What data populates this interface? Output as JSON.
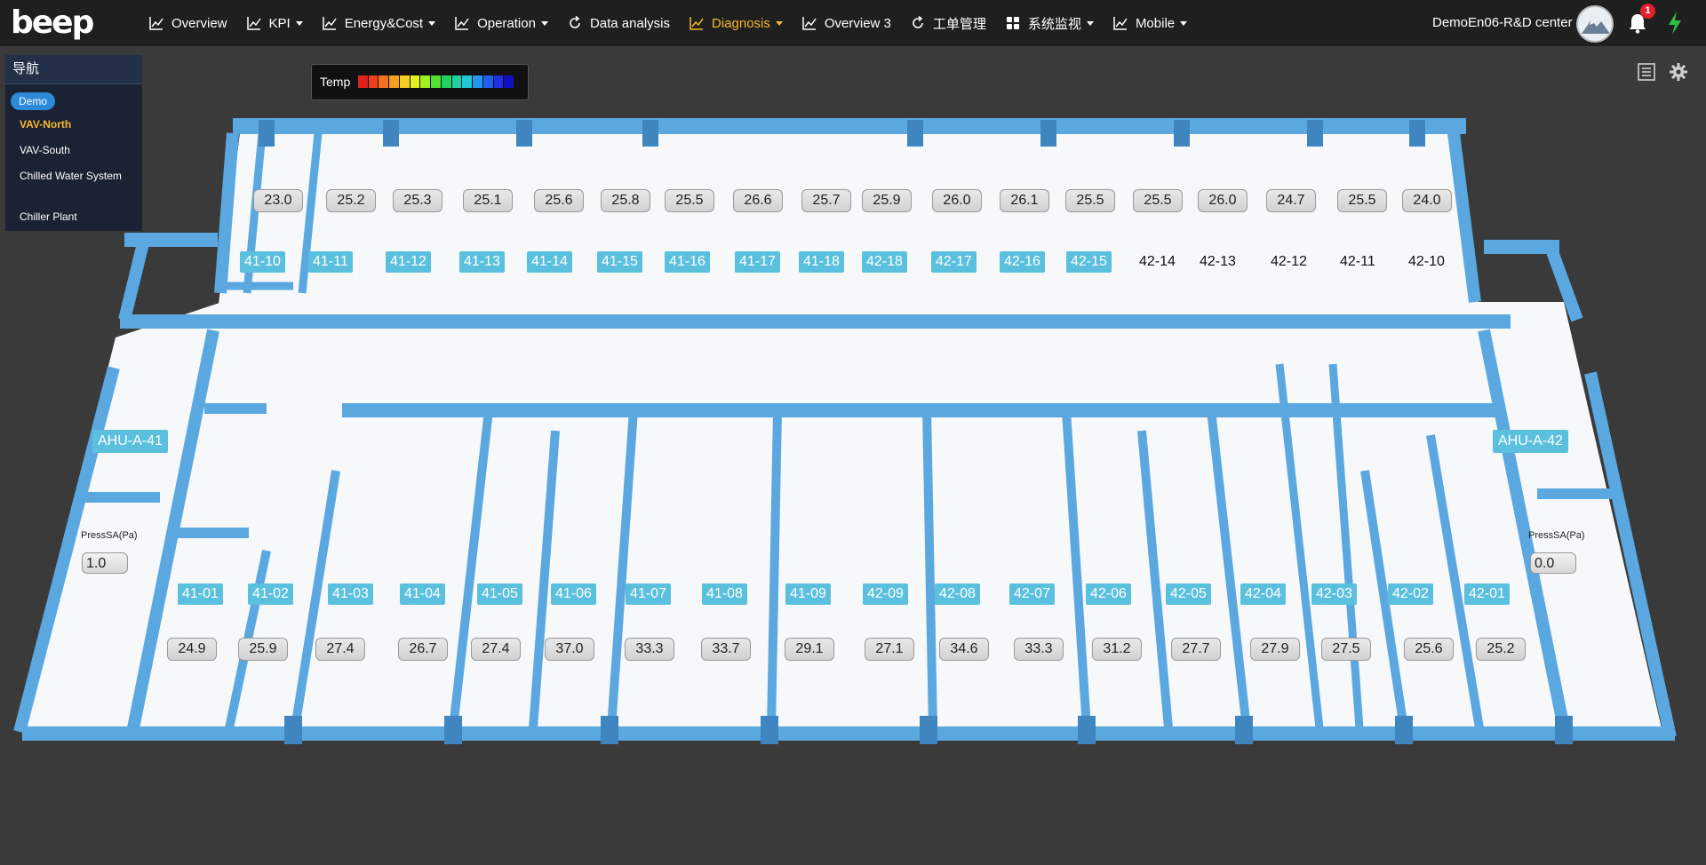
{
  "header": {
    "logo_text": "beep",
    "nav": [
      {
        "label": "Overview",
        "dropdown": false,
        "active": false,
        "icon": "line-chart-icon"
      },
      {
        "label": "KPI",
        "dropdown": true,
        "active": false,
        "icon": "line-chart-icon"
      },
      {
        "label": "Energy&Cost",
        "dropdown": true,
        "active": false,
        "icon": "line-chart-icon"
      },
      {
        "label": "Operation",
        "dropdown": true,
        "active": false,
        "icon": "line-chart-icon"
      },
      {
        "label": "Data analysis",
        "dropdown": false,
        "active": false,
        "icon": "refresh-icon"
      },
      {
        "label": "Diagnosis",
        "dropdown": true,
        "active": true,
        "icon": "line-chart-icon"
      },
      {
        "label": "Overview 3",
        "dropdown": false,
        "active": false,
        "icon": "line-chart-icon"
      },
      {
        "label": "工单管理",
        "dropdown": false,
        "active": false,
        "icon": "refresh-icon"
      },
      {
        "label": "系统监视",
        "dropdown": true,
        "active": false,
        "icon": "grid-icon"
      },
      {
        "label": "Mobile",
        "dropdown": true,
        "active": false,
        "icon": "line-chart-icon"
      }
    ],
    "user_name": "DemoEn06-R&D center",
    "notification_count": "1",
    "active_color": "#f5b82e"
  },
  "sidebar": {
    "title": "导航",
    "demo_label": "Demo",
    "items": [
      {
        "label": "VAV-North",
        "active": true
      },
      {
        "label": "VAV-South",
        "active": false
      },
      {
        "label": "Chilled Water System",
        "active": false
      },
      {
        "label": "Chiller Plant",
        "active": false
      }
    ]
  },
  "legend": {
    "label": "Temp",
    "colors": [
      "#e0201a",
      "#f0401a",
      "#f57020",
      "#f5a020",
      "#f5d020",
      "#e0f020",
      "#a0f020",
      "#50e030",
      "#20d060",
      "#20d0a0",
      "#20c8d8",
      "#2098f0",
      "#2060f0",
      "#2030e0",
      "#1010c0"
    ]
  },
  "floor_plan": {
    "north_rooms": [
      {
        "id": "41-10",
        "temp": "23.0",
        "labeled": true
      },
      {
        "id": "41-11",
        "temp": "25.2",
        "labeled": true
      },
      {
        "id": "41-12",
        "temp": "25.3",
        "labeled": true
      },
      {
        "id": "41-13",
        "temp": "25.1",
        "labeled": true
      },
      {
        "id": "41-14",
        "temp": "25.6",
        "labeled": true
      },
      {
        "id": "41-15",
        "temp": "25.8",
        "labeled": true
      },
      {
        "id": "41-16",
        "temp": "25.5",
        "labeled": true
      },
      {
        "id": "41-17",
        "temp": "26.6",
        "labeled": true
      },
      {
        "id": "41-18",
        "temp": "25.7",
        "labeled": true
      },
      {
        "id": "42-18",
        "temp": "25.9",
        "labeled": true
      },
      {
        "id": "42-17",
        "temp": "26.0",
        "labeled": true
      },
      {
        "id": "42-16",
        "temp": "26.1",
        "labeled": true
      },
      {
        "id": "42-15",
        "temp": "25.5",
        "labeled": true
      },
      {
        "id": "42-14",
        "temp": "25.5",
        "labeled": false
      },
      {
        "id": "42-13",
        "temp": "26.0",
        "labeled": false
      },
      {
        "id": "42-12",
        "temp": "24.7",
        "labeled": false
      },
      {
        "id": "42-11",
        "temp": "25.5",
        "labeled": false
      },
      {
        "id": "42-10",
        "temp": "24.0",
        "labeled": false
      }
    ],
    "south_rooms": [
      {
        "id": "41-01",
        "temp": "24.9"
      },
      {
        "id": "41-02",
        "temp": "25.9"
      },
      {
        "id": "41-03",
        "temp": "27.4"
      },
      {
        "id": "41-04",
        "temp": "26.7"
      },
      {
        "id": "41-05",
        "temp": "27.4"
      },
      {
        "id": "41-06",
        "temp": "37.0"
      },
      {
        "id": "41-07",
        "temp": "33.3"
      },
      {
        "id": "41-08",
        "temp": "33.7"
      },
      {
        "id": "41-09",
        "temp": "29.1"
      },
      {
        "id": "42-09",
        "temp": "27.1"
      },
      {
        "id": "42-08",
        "temp": "34.6"
      },
      {
        "id": "42-07",
        "temp": "33.3"
      },
      {
        "id": "42-06",
        "temp": "31.2"
      },
      {
        "id": "42-05",
        "temp": "27.7"
      },
      {
        "id": "42-04",
        "temp": "27.9"
      },
      {
        "id": "42-03",
        "temp": "27.5"
      },
      {
        "id": "42-02",
        "temp": "25.6"
      },
      {
        "id": "42-01",
        "temp": "25.2"
      }
    ],
    "ahu_left": {
      "label": "AHU-A-41",
      "press_label": "PressSA(Pa)",
      "press_value": "1.0"
    },
    "ahu_right": {
      "label": "AHU-A-42",
      "press_label": "PressSA(Pa)",
      "press_value": "0.0"
    },
    "wall_color": "#5ba8e0",
    "floor_color": "#f6f8fa"
  }
}
